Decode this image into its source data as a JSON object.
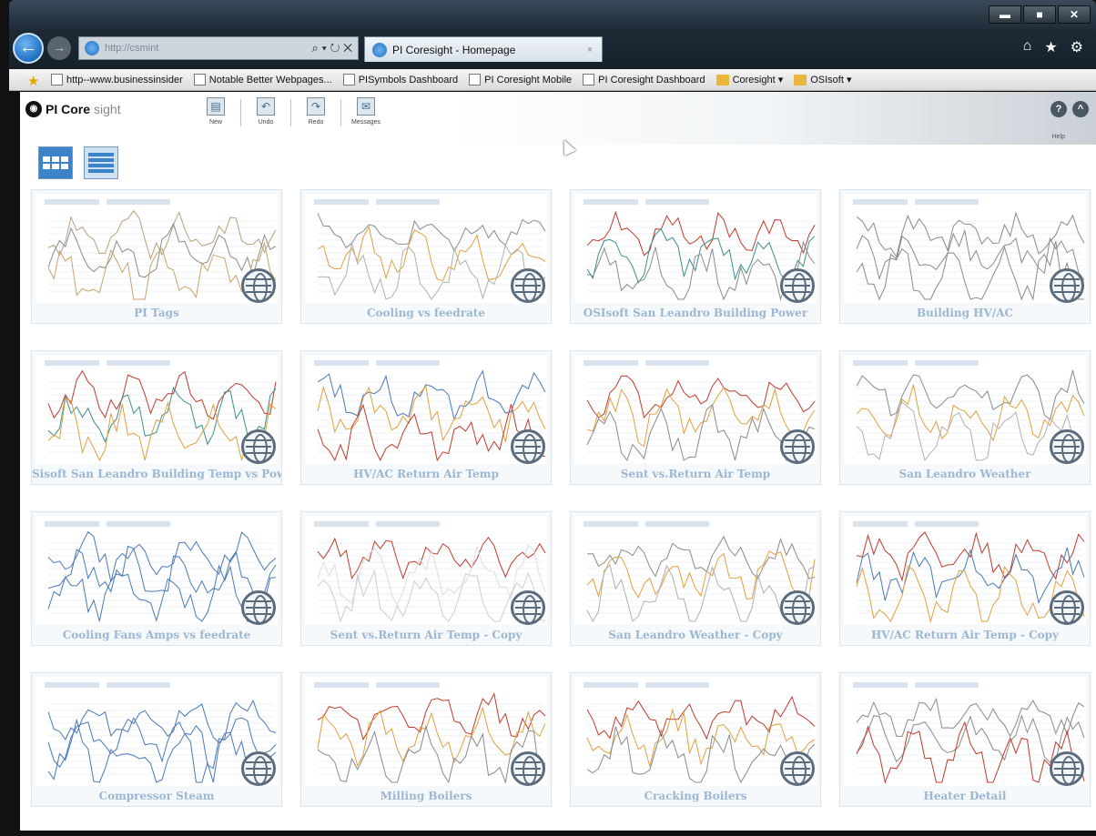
{
  "browser": {
    "address_url": "http://csmint",
    "address_url_host": "csmint",
    "address_tools": "⌕ ▾ ↻ ✕",
    "tab_title": "PI Coresight - Homepage",
    "tab_close": "×",
    "window_buttons": [
      "▬",
      "■",
      "✕"
    ],
    "right_icons": [
      "⌂",
      "★",
      "⚙"
    ]
  },
  "favorites": [
    {
      "label": "http--www.businessinsider",
      "icon": "page-icon"
    },
    {
      "label": "Notable Better Webpages...",
      "icon": "page-icon"
    },
    {
      "label": "PISymbols Dashboard",
      "icon": "page-icon"
    },
    {
      "label": "PI Coresight Mobile",
      "icon": "page-icon"
    },
    {
      "label": "PI Coresight Dashboard",
      "icon": "page-icon"
    },
    {
      "label": "Coresight ▾",
      "icon": "folder-icon"
    },
    {
      "label": "OSIsoft ▾",
      "icon": "folder-icon"
    }
  ],
  "app": {
    "logo_bold": "PI Core",
    "logo_light": "sight",
    "toolbar": [
      {
        "label": "New",
        "icon": "new-icon"
      },
      {
        "label": "Undo",
        "icon": "undo-icon"
      },
      {
        "label": "Redo",
        "icon": "redo-icon"
      },
      {
        "label": "Messages",
        "icon": "messages-icon"
      }
    ],
    "help_label": "Help"
  },
  "tiles": [
    {
      "title": "PI Tags"
    },
    {
      "title": "Cooling vs feedrate"
    },
    {
      "title": "OSIsoft San Leandro Building Power"
    },
    {
      "title": "Building HV/AC"
    },
    {
      "title": "Sisoft San Leandro Building Temp vs Powe"
    },
    {
      "title": "HV/AC Return Air Temp"
    },
    {
      "title": "Sent vs.Return Air Temp"
    },
    {
      "title": "San Leandro Weather"
    },
    {
      "title": "Cooling Fans Amps vs feedrate"
    },
    {
      "title": "Sent vs.Return Air Temp - Copy"
    },
    {
      "title": "San Leandro Weather - Copy"
    },
    {
      "title": "HV/AC Return Air Temp - Copy"
    },
    {
      "title": "Compressor Steam"
    },
    {
      "title": "Milling Boilers"
    },
    {
      "title": "Cracking Boilers"
    },
    {
      "title": "Heater Detail"
    }
  ],
  "colors": {
    "tile_title": "#9ab7d3",
    "active_view": "#3c83c9",
    "trend_red": "#c0392b",
    "trend_blue": "#4a78b5",
    "trend_orange": "#e0a040",
    "trend_gray": "#8a8a8a"
  }
}
